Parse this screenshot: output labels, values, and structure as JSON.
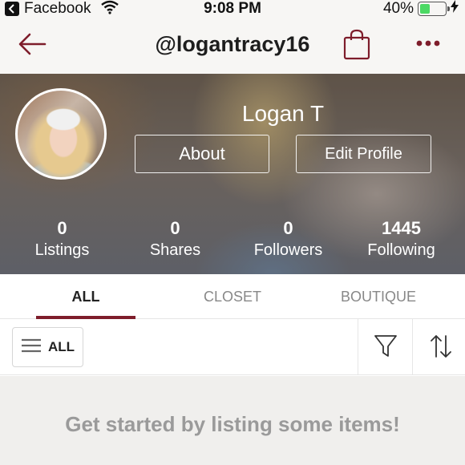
{
  "status_bar": {
    "back_app": "Facebook",
    "time": "9:08 PM",
    "battery": "40%",
    "battery_level": 0.4,
    "battery_color": "#4cd964"
  },
  "nav": {
    "username": "@logantracy16",
    "accent": "#7e1d2b",
    "icons": [
      "back-arrow-icon",
      "shopping-bag-icon",
      "more-icon"
    ]
  },
  "profile": {
    "name": "Logan T",
    "about_label": "About",
    "edit_label": "Edit Profile",
    "stats": [
      {
        "value": "0",
        "label": "Listings"
      },
      {
        "value": "0",
        "label": "Shares"
      },
      {
        "value": "0",
        "label": "Followers"
      },
      {
        "value": "1445",
        "label": "Following"
      }
    ]
  },
  "tabs": [
    {
      "label": "ALL",
      "active": true
    },
    {
      "label": "CLOSET",
      "active": false
    },
    {
      "label": "BOUTIQUE",
      "active": false
    }
  ],
  "toolbar": {
    "filter_label": "ALL",
    "icons": [
      "menu-icon",
      "filter-icon",
      "sort-icon"
    ]
  },
  "empty_state": {
    "message": "Get started by listing some items!"
  }
}
